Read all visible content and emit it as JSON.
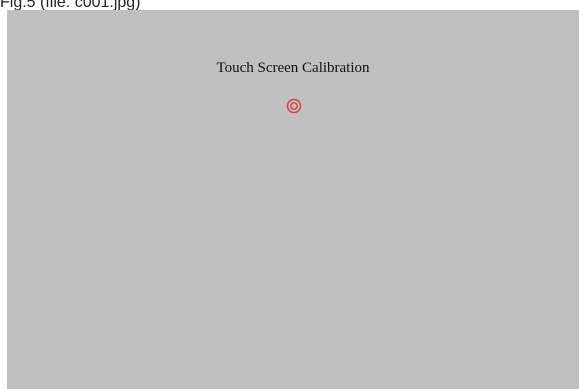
{
  "caption": "Fig.5 (file: c001.jpg)",
  "screen": {
    "title": "Touch Screen Calibration",
    "background_color": "#c0c0c0",
    "target": {
      "icon": "calibration-crosshair-target-icon",
      "color": "#e03a3a"
    }
  }
}
